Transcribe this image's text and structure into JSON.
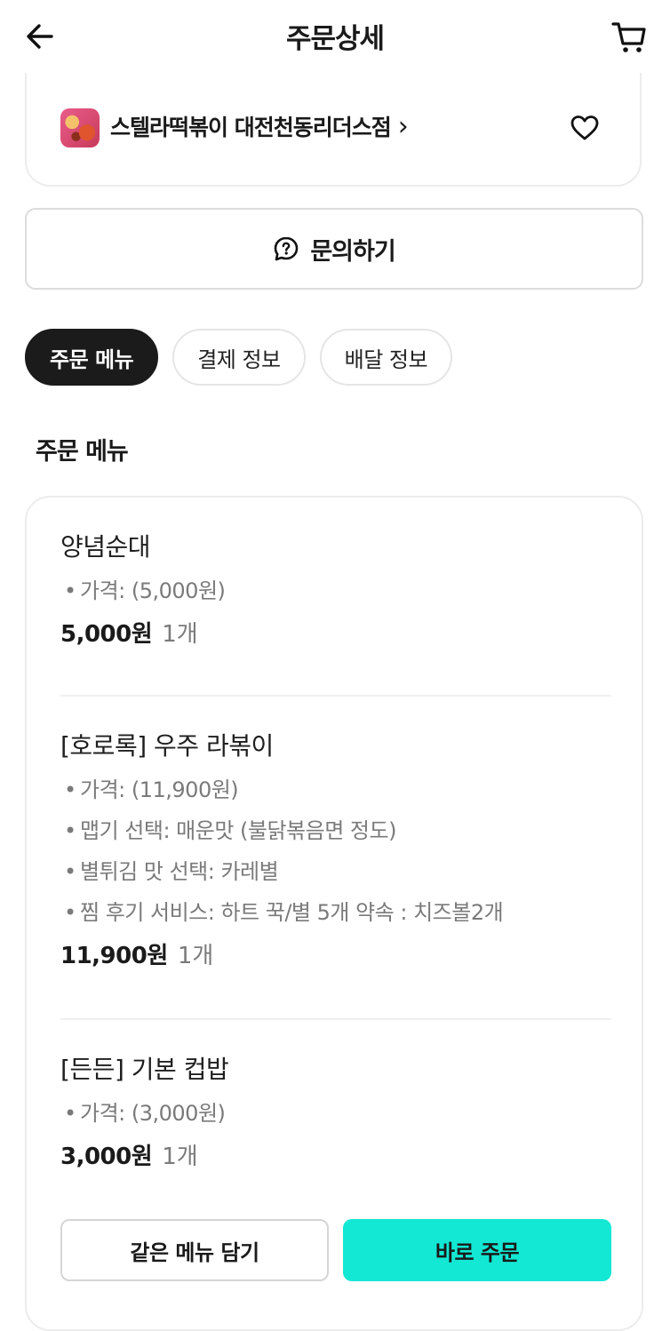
{
  "header": {
    "title": "주문상세"
  },
  "store": {
    "name": "스텔라떡볶이 대전천동리더스점",
    "chevron": "›"
  },
  "inquiry": {
    "label": "문의하기"
  },
  "tabs": [
    {
      "label": "주문 메뉴",
      "active": true
    },
    {
      "label": "결제 정보",
      "active": false
    },
    {
      "label": "배달 정보",
      "active": false
    }
  ],
  "section": {
    "title": "주문 메뉴"
  },
  "items": [
    {
      "name": "양념순대",
      "options": [
        "가격:  (5,000원)"
      ],
      "price": "5,000원",
      "qty": "1개"
    },
    {
      "name": "[호로록] 우주 라볶이",
      "options": [
        "가격:  (11,900원)",
        "맵기 선택: 매운맛 (불닭볶음면 정도)",
        "별튀김 맛 선택: 카레별",
        "찜 후기 서비스: 하트 꾹/별 5개 약속 : 치즈볼2개"
      ],
      "price": "11,900원",
      "qty": "1개"
    },
    {
      "name": "[든든] 기본 컵밥",
      "options": [
        "가격:  (3,000원)"
      ],
      "price": "3,000원",
      "qty": "1개"
    }
  ],
  "actions": {
    "same_menu": "같은 메뉴 담기",
    "order_now": "바로 주문"
  },
  "icons": {
    "back": "arrow-left-icon",
    "cart": "cart-icon",
    "heart": "heart-outline-icon",
    "inquiry": "question-bubble-icon",
    "store_logo": "store-logo"
  },
  "colors": {
    "accent": "#12e8d3",
    "active_tab": "#1b1b1b",
    "muted_text": "#7a7a7a"
  }
}
